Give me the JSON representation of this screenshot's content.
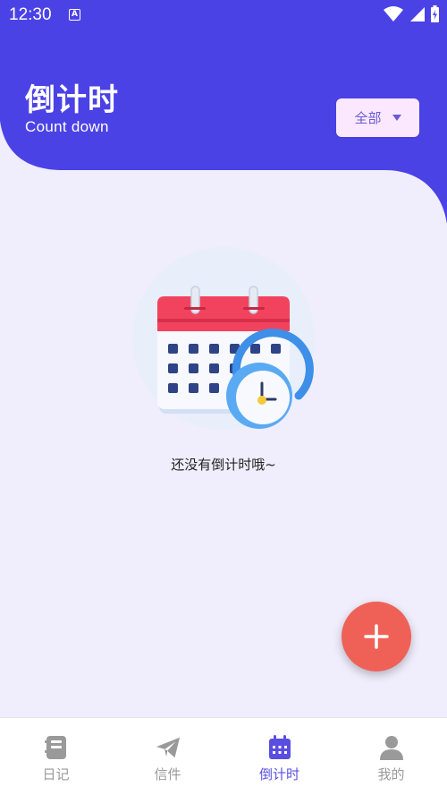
{
  "status_bar": {
    "time": "12:30",
    "notification_letter": "A",
    "icons": [
      "wifi-icon",
      "signal-icon",
      "battery-charging-icon"
    ]
  },
  "header": {
    "title": "倒计时",
    "subtitle": "Count down",
    "filter_label": "全部",
    "colors": {
      "header_bg": "#4b42e6",
      "filter_bg": "#fbe8ff",
      "filter_text": "#6a5bd0"
    }
  },
  "empty_state": {
    "message": "还没有倒计时哦~",
    "illustration": "calendar-clock-icon"
  },
  "fab": {
    "icon": "plus-icon",
    "color": "#ef6156"
  },
  "bottom_nav": {
    "items": [
      {
        "label": "日记",
        "icon": "notebook-icon",
        "active": false
      },
      {
        "label": "信件",
        "icon": "paper-plane-icon",
        "active": false
      },
      {
        "label": "倒计时",
        "icon": "calendar-icon",
        "active": true
      },
      {
        "label": "我的",
        "icon": "user-icon",
        "active": false
      }
    ],
    "colors": {
      "active": "#5a4ee0",
      "inactive": "#9a9a9a"
    }
  }
}
